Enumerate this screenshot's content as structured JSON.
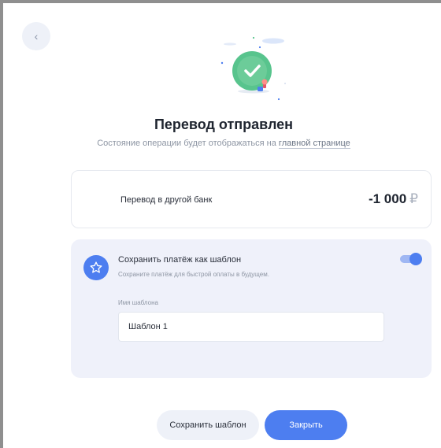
{
  "header": {
    "back_icon": "chevron-left-icon",
    "title": "Перевод отправлен",
    "subtitle_prefix": "Состояние операции будет отображаться на ",
    "subtitle_link": "главной странице"
  },
  "transfer": {
    "label": "Перевод в другой банк",
    "amount": "-1 000",
    "currency": "₽"
  },
  "template": {
    "icon": "star-icon",
    "title": "Сохранить платёж как шаблон",
    "description": "Сохраните платёж для быстрой оплаты в будущем.",
    "toggle_on": true,
    "name_label": "Имя шаблона",
    "name_value": "Шаблон 1"
  },
  "actions": {
    "save_label": "Сохранить шаблон",
    "close_label": "Закрыть"
  },
  "colors": {
    "accent": "#4d7ef0",
    "success": "#58c48d",
    "card_bg": "#eff1fa"
  }
}
